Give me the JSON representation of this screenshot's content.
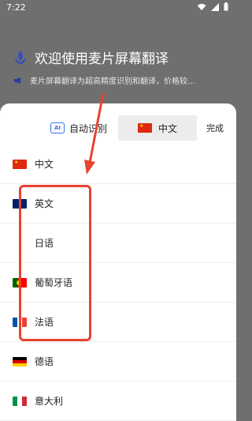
{
  "status": {
    "time": "7:22"
  },
  "background": {
    "title": "欢迎使用麦片屏幕翻译",
    "subtitle": "麦片屏幕翻译为超高精度识别和翻译，价格较..."
  },
  "sheet": {
    "auto_label": "自动识别",
    "ai_icon_text": "AI",
    "target_label": "中文",
    "done_label": "完成",
    "languages": [
      {
        "label": "中文",
        "flag": "flag-cn"
      },
      {
        "label": "英文",
        "flag": "flag-uk"
      },
      {
        "label": "日语",
        "flag": "flag-jp"
      },
      {
        "label": "葡萄牙语",
        "flag": "flag-pt"
      },
      {
        "label": "法语",
        "flag": "flag-fr"
      },
      {
        "label": "德语",
        "flag": "flag-de"
      },
      {
        "label": "意大利",
        "flag": "flag-it"
      }
    ]
  },
  "colors": {
    "accent": "#3b6cf6",
    "annotation": "#e8432f"
  }
}
